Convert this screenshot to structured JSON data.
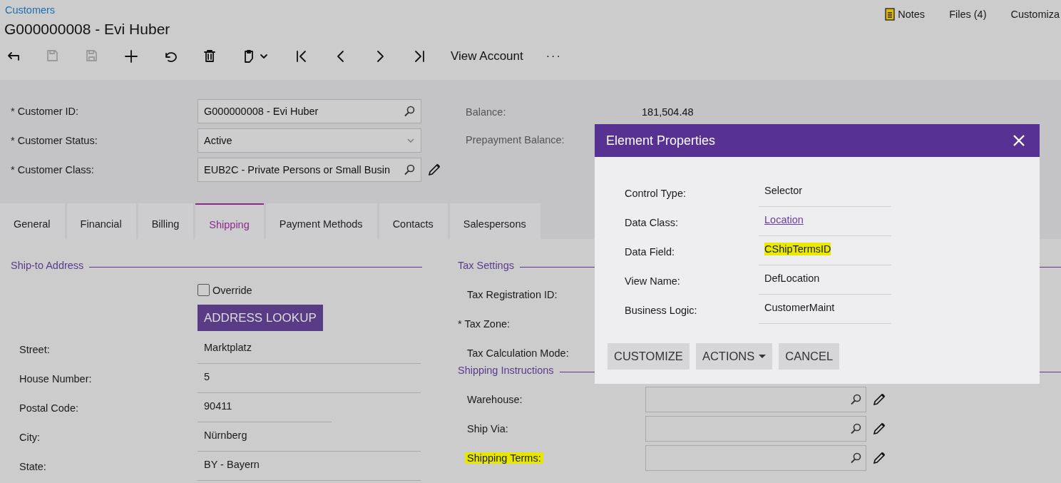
{
  "breadcrumb": "Customers",
  "title": "G000000008 - Evi Huber",
  "top_links": [
    {
      "label": "Notes",
      "kind": "notes"
    },
    {
      "label": "Files (4)",
      "kind": "plain"
    },
    {
      "label": "Customiza",
      "kind": "plain"
    }
  ],
  "toolbar": [
    {
      "kind": "back",
      "disabled": false
    },
    {
      "kind": "save-close",
      "disabled": true
    },
    {
      "kind": "save",
      "disabled": true
    },
    {
      "kind": "add",
      "disabled": false
    },
    {
      "kind": "undo",
      "disabled": false
    },
    {
      "kind": "delete",
      "disabled": false
    },
    {
      "kind": "copy",
      "disabled": false
    },
    {
      "kind": "first",
      "disabled": false
    },
    {
      "kind": "prev",
      "disabled": false
    },
    {
      "kind": "next",
      "disabled": false
    },
    {
      "kind": "last",
      "disabled": false
    },
    {
      "kind": "text",
      "label": "View Account",
      "disabled": false
    },
    {
      "kind": "more",
      "label": "···",
      "disabled": false
    }
  ],
  "summary": {
    "fields": [
      {
        "label": "* Customer ID:",
        "value": "G000000008 - Evi Huber",
        "kind": "selector",
        "editable": false
      },
      {
        "label": "* Customer Status:",
        "value": "Active",
        "kind": "dropdown",
        "editable": false
      },
      {
        "label": "* Customer Class:",
        "value": "EUB2C - Private Persons or Small Busin",
        "kind": "selector",
        "editable": true
      }
    ],
    "totals": [
      {
        "label": "Balance:",
        "value": "181,504.48"
      },
      {
        "label": "Prepayment Balance:"
      }
    ]
  },
  "tabs": [
    {
      "label": "General",
      "selected": false
    },
    {
      "label": "Financial",
      "selected": false
    },
    {
      "label": "Billing",
      "selected": false
    },
    {
      "label": "Shipping",
      "selected": true
    },
    {
      "label": "Payment Methods",
      "selected": false
    },
    {
      "label": "Contacts",
      "selected": false
    },
    {
      "label": "Salespersons",
      "selected": false
    }
  ],
  "ship_to": {
    "title": "Ship-to Address",
    "override": {
      "label": "Override",
      "checked": false
    },
    "lookup_button": "ADDRESS LOOKUP",
    "fields": [
      {
        "label": "Street:",
        "value": "Marktplatz"
      },
      {
        "label": "House Number:",
        "value": "5"
      },
      {
        "label": "Postal Code:",
        "value": "90411"
      },
      {
        "label": "City:",
        "value": "Nürnberg"
      },
      {
        "label": "State:",
        "value": "BY - Bayern"
      }
    ]
  },
  "tax_settings": {
    "title": "Tax Settings",
    "fields": [
      {
        "label": "Tax Registration ID:"
      },
      {
        "label": "* Tax Zone:"
      },
      {
        "label": "Tax Calculation Mode:"
      }
    ]
  },
  "shipping_instructions": {
    "title": "Shipping Instructions",
    "fields": [
      {
        "label": "Warehouse:",
        "highlighted": false
      },
      {
        "label": "Ship Via:",
        "highlighted": false
      },
      {
        "label": "Shipping Terms:",
        "highlighted": true
      }
    ]
  },
  "dialog": {
    "title": "Element Properties",
    "rows": [
      {
        "label": "Control Type:",
        "value": "Selector",
        "kind": "text",
        "highlighted": false
      },
      {
        "label": "Data Class:",
        "value": "Location",
        "kind": "link",
        "highlighted": false
      },
      {
        "label": "Data Field:",
        "value": "CShipTermsID",
        "kind": "text",
        "highlighted": true
      },
      {
        "label": "View Name:",
        "value": "DefLocation",
        "kind": "text",
        "highlighted": false
      },
      {
        "label": "Business Logic:",
        "value": "CustomerMaint",
        "kind": "text",
        "highlighted": false
      }
    ],
    "buttons": [
      {
        "label": "CUSTOMIZE",
        "kind": "plain"
      },
      {
        "label": "ACTIONS",
        "kind": "menu"
      },
      {
        "label": "CANCEL",
        "kind": "plain"
      }
    ]
  }
}
